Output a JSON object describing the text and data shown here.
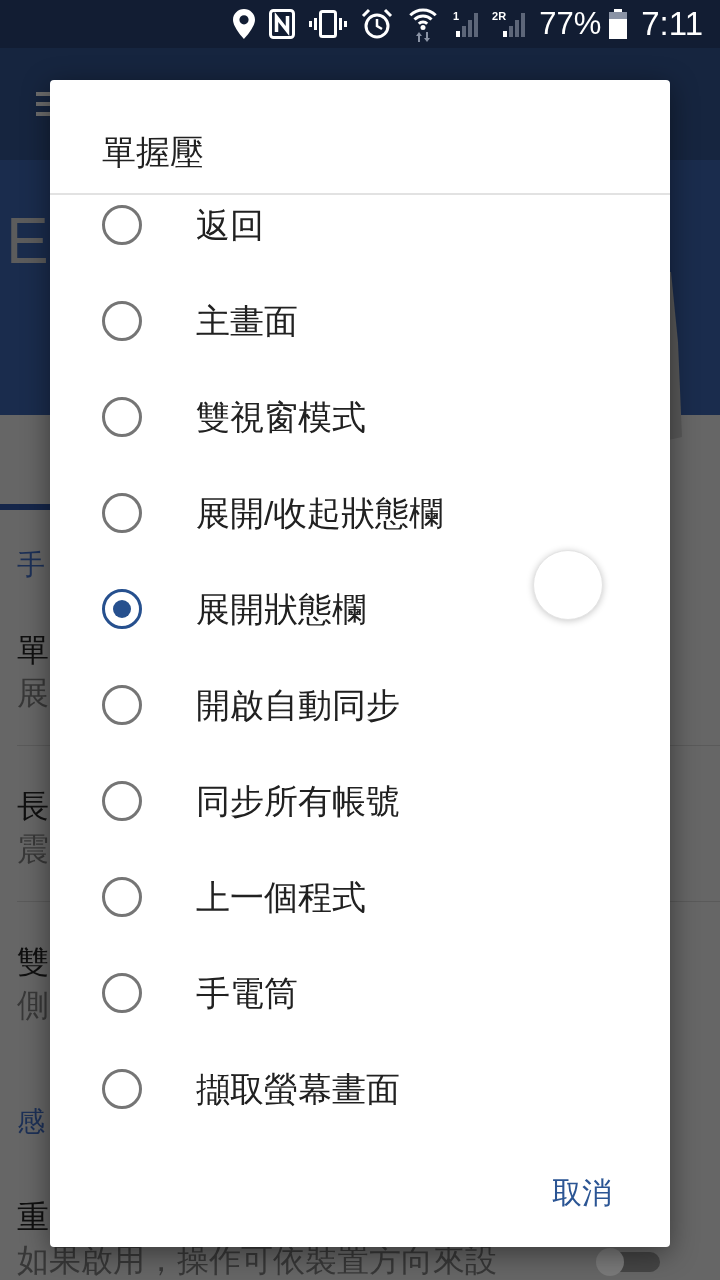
{
  "status_bar": {
    "sim_labels": [
      "1",
      "2R"
    ],
    "battery": "77%",
    "time": "7:11"
  },
  "header": {
    "title": "E"
  },
  "sections": [
    {
      "title": "手",
      "items": [
        {
          "title": "單",
          "subtitle": "展"
        },
        {
          "title": "長",
          "subtitle": "震"
        },
        {
          "title": "雙",
          "subtitle": "側"
        }
      ]
    },
    {
      "title": "感",
      "items": [
        {
          "title": "重",
          "subtitle": "如果啟用，操作可依裝置方向來設",
          "toggle": {
            "on": false
          }
        }
      ]
    }
  ],
  "dialog": {
    "title": "單握壓",
    "options": [
      {
        "label": "返回",
        "selected": false
      },
      {
        "label": "主畫面",
        "selected": false
      },
      {
        "label": "雙視窗模式",
        "selected": false
      },
      {
        "label": "展開/收起狀態欄",
        "selected": false
      },
      {
        "label": "展開狀態欄",
        "selected": true
      },
      {
        "label": "開啟自動同步",
        "selected": false
      },
      {
        "label": "同步所有帳號",
        "selected": false
      },
      {
        "label": "上一個程式",
        "selected": false
      },
      {
        "label": "手電筒",
        "selected": false
      },
      {
        "label": "擷取螢幕畫面",
        "selected": false
      }
    ],
    "buttons": [
      "取消"
    ]
  }
}
